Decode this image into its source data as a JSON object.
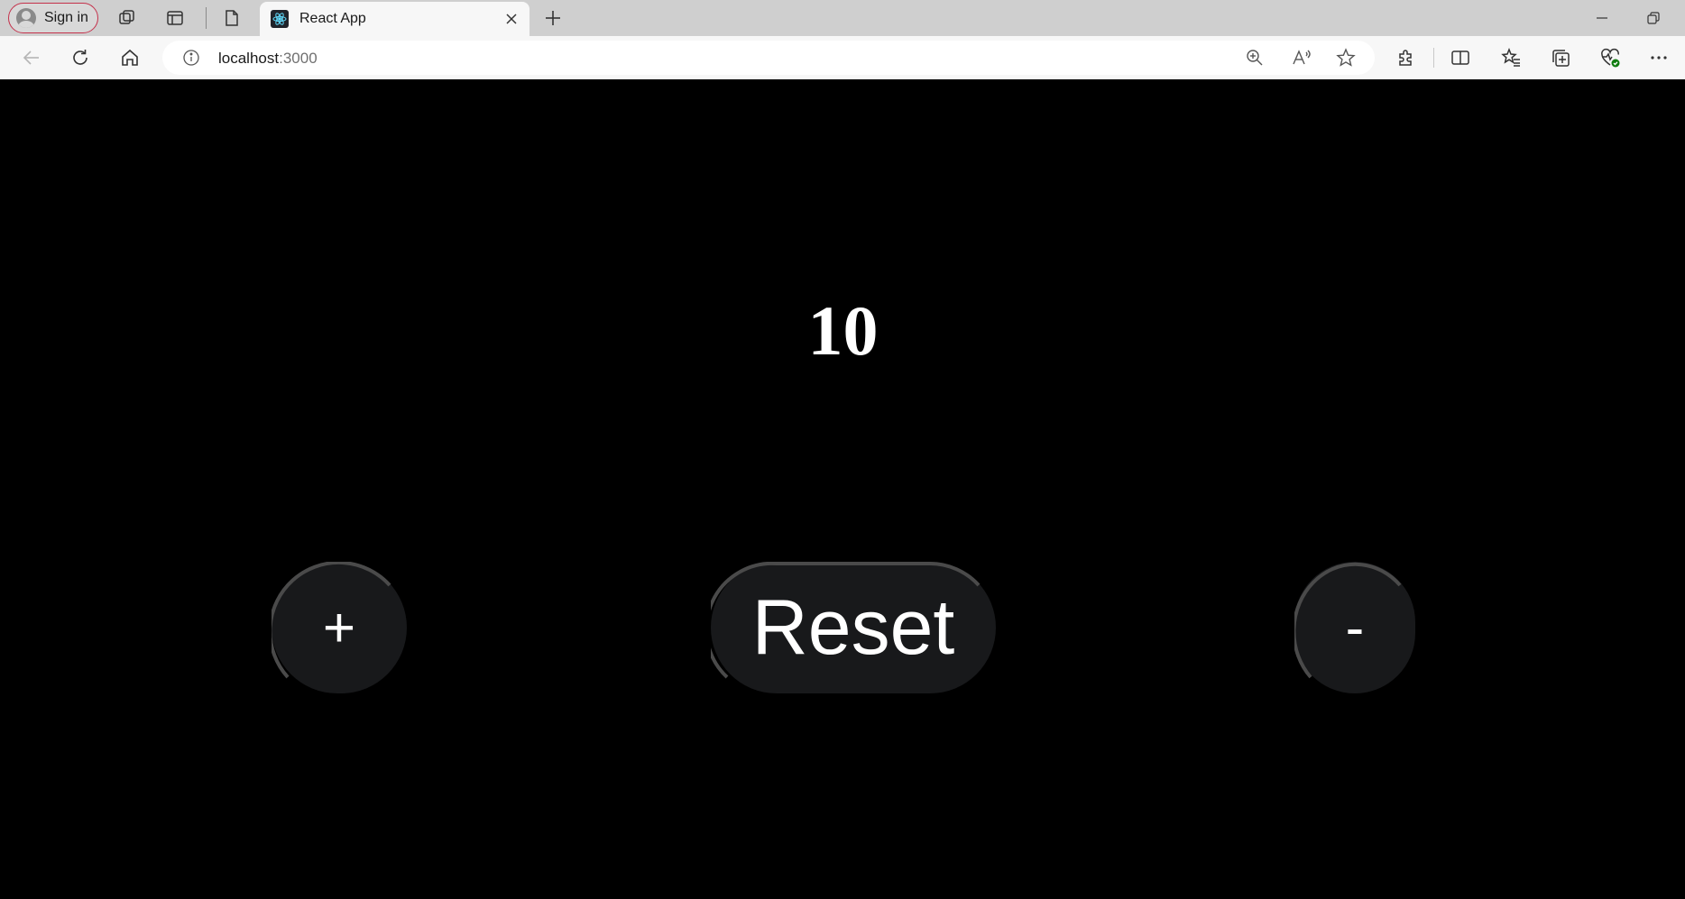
{
  "browser": {
    "signin_label": "Sign in",
    "tab_title": "React App",
    "url_host": "localhost",
    "url_port": ":3000",
    "icons": [
      "workspaces-icon",
      "vertical-tabs-icon",
      "page-icon",
      "react-favicon-icon",
      "close-icon",
      "new-tab-icon",
      "minimize-icon",
      "restore-icon",
      "back-icon",
      "refresh-icon",
      "home-icon",
      "site-info-icon",
      "zoom-icon",
      "read-aloud-icon",
      "favorite-star-icon",
      "extensions-icon",
      "split-screen-icon",
      "favorites-icon",
      "collections-icon",
      "browser-essentials-icon",
      "more-icon"
    ]
  },
  "app": {
    "counter_value": "10",
    "increment_label": "+",
    "reset_label": "Reset",
    "decrement_label": "-"
  },
  "colors": {
    "page_background": "#000000",
    "button_background": "#18191b",
    "button_text": "#ffffff",
    "button_arc": "#4a4a4a",
    "signin_border": "#c4314b"
  }
}
